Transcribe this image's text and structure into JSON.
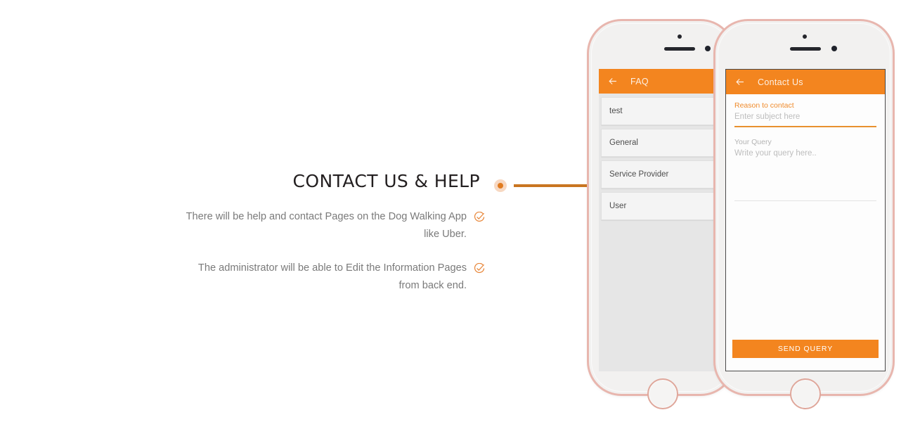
{
  "feature": {
    "title": "CONTACT US & HELP",
    "bullets": [
      "There will be help and contact Pages on the Dog Walking App like Uber.",
      "The administrator will be able to Edit the Information Pages from back end."
    ]
  },
  "colors": {
    "accent_orange": "#f3851f",
    "connector_line": "#c97520",
    "connector_dot": "#e07b20",
    "connector_halo": "#f7d8c2",
    "phone_frame": "#e8b6ae",
    "title_text": "#231f20",
    "bullet_text": "#7a7a7a"
  },
  "phone_left": {
    "appbar": {
      "back_icon": "arrow-left-icon",
      "title": "FAQ"
    },
    "faq_items": [
      {
        "label": "test"
      },
      {
        "label": "General"
      },
      {
        "label": "Service Provider"
      },
      {
        "label": "User"
      }
    ]
  },
  "phone_right": {
    "appbar": {
      "back_icon": "arrow-left-icon",
      "title": "Contact Us"
    },
    "form": {
      "subject_label": "Reason to contact",
      "subject_placeholder": "Enter subject here",
      "subject_value": "",
      "query_label": "Your Query",
      "query_placeholder": "Write your query here..",
      "query_value": "",
      "submit_label": "SEND QUERY"
    }
  }
}
